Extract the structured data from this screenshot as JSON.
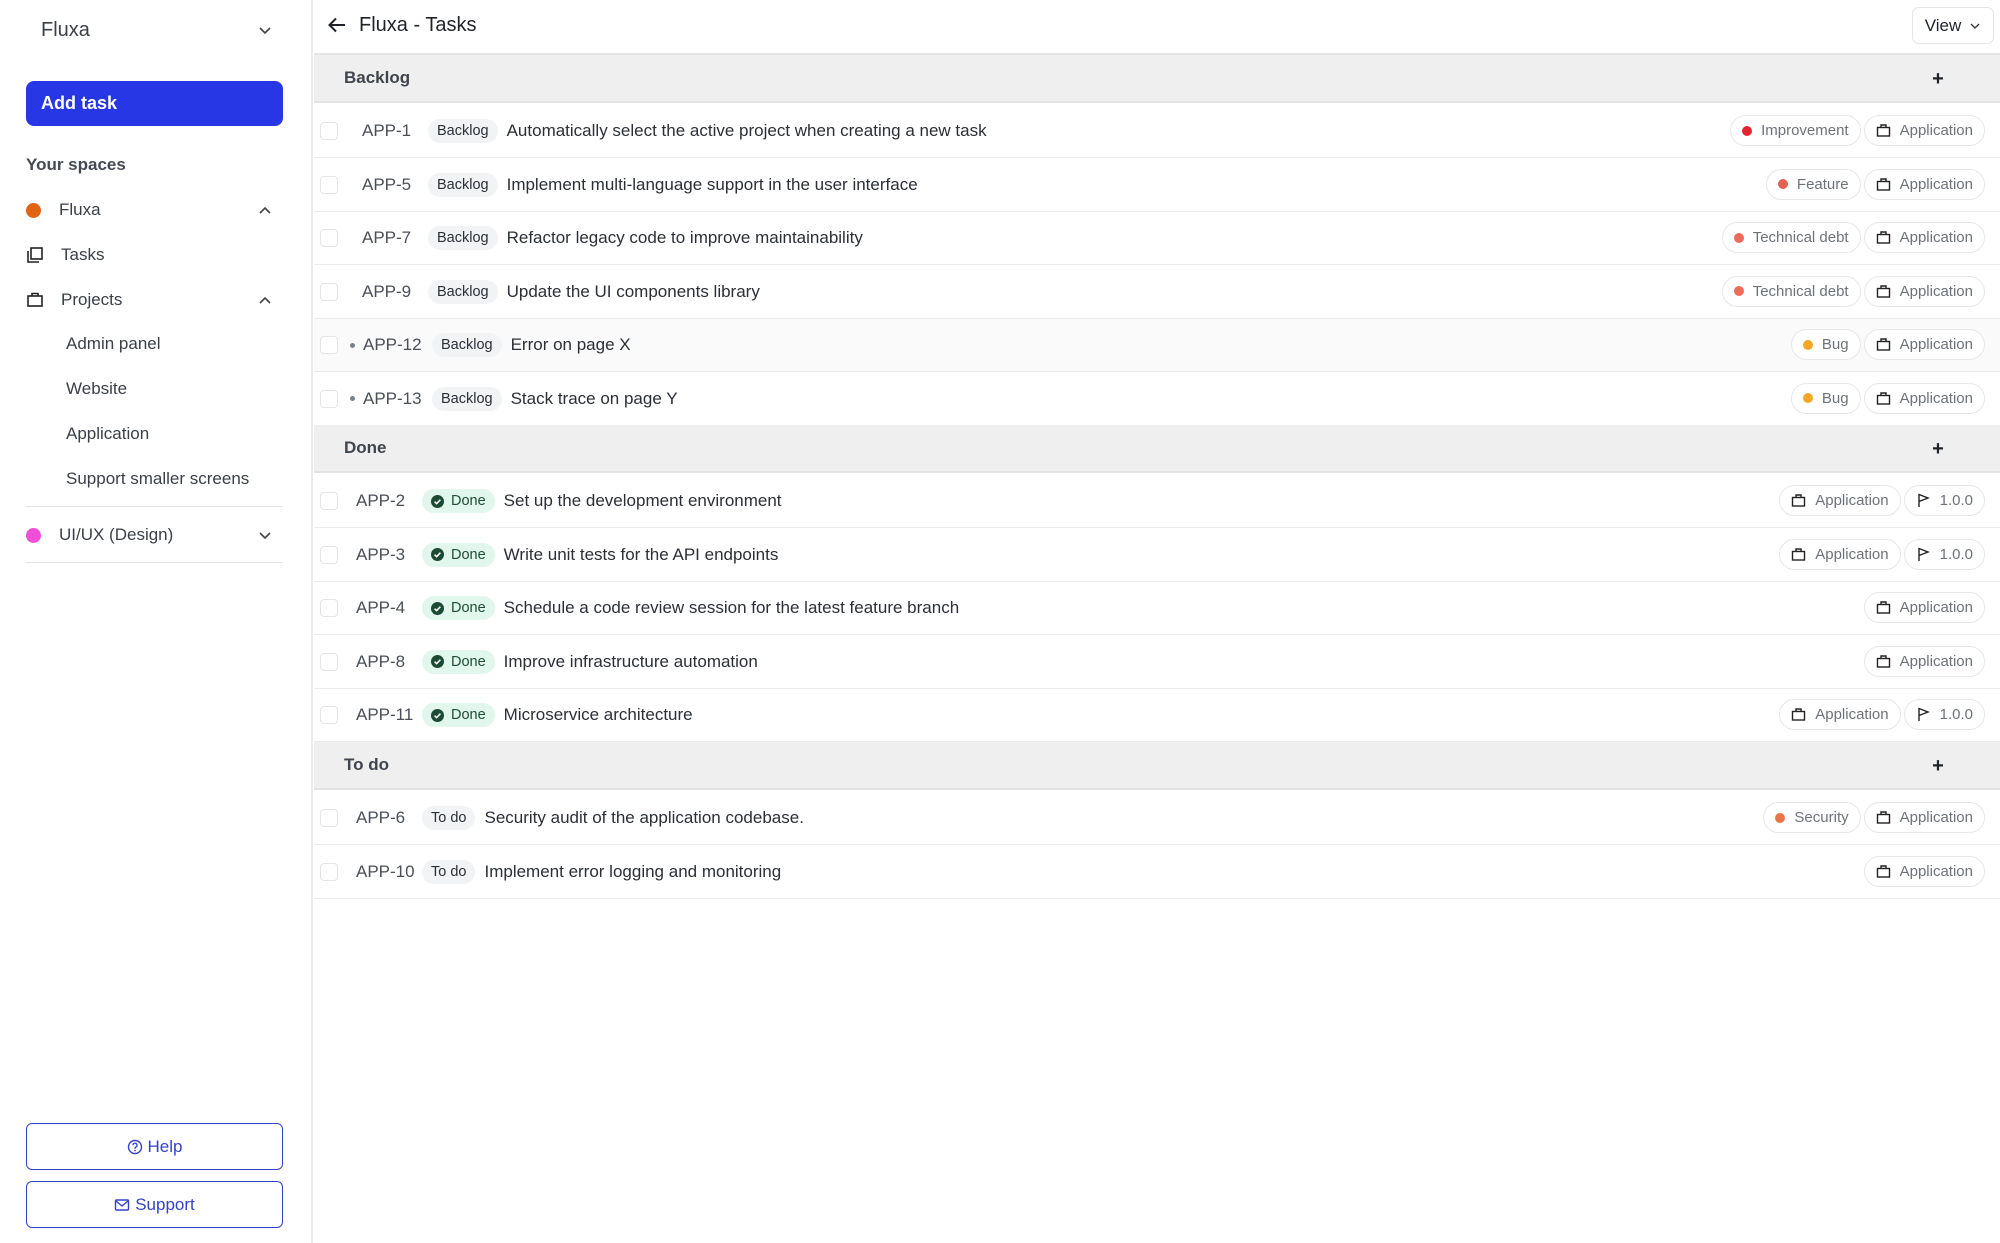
{
  "sidebar": {
    "workspace_name": "Fluxa",
    "add_task_label": "Add task",
    "spaces_title": "Your spaces",
    "spaces": [
      {
        "name": "Fluxa",
        "color": "#df6514",
        "expanded": true
      },
      {
        "name": "UI/UX (Design)",
        "color": "#f24fd8",
        "expanded": false
      }
    ],
    "nav": {
      "tasks_label": "Tasks",
      "projects_label": "Projects",
      "projects": [
        "Admin panel",
        "Website",
        "Application",
        "Support smaller screens"
      ]
    },
    "help_label": "Help",
    "support_label": "Support"
  },
  "header": {
    "title": "Fluxa - Tasks",
    "view_label": "View"
  },
  "colors": {
    "accent": "#2837e6",
    "improvement": "#e5252f",
    "feature": "#e4614f",
    "technical_debt": "#ef6a5a",
    "bug": "#f5a623",
    "security": "#e87448",
    "done_bg": "#e1f6ec"
  },
  "groups": [
    {
      "title": "Backlog",
      "add_label": "+",
      "tasks": [
        {
          "key": "APP-1",
          "status": "Backlog",
          "title": "Automatically select the active project when creating a new task",
          "label": "Improvement",
          "label_color": "#e5252f",
          "project": "Application"
        },
        {
          "key": "APP-5",
          "status": "Backlog",
          "title": "Implement multi-language support in the user interface",
          "label": "Feature",
          "label_color": "#e4614f",
          "project": "Application"
        },
        {
          "key": "APP-7",
          "status": "Backlog",
          "title": "Refactor legacy code to improve maintainability",
          "label": "Technical debt",
          "label_color": "#ef6a5a",
          "project": "Application"
        },
        {
          "key": "APP-9",
          "status": "Backlog",
          "title": "Update the UI components library",
          "label": "Technical debt",
          "label_color": "#ef6a5a",
          "project": "Application"
        },
        {
          "key": "APP-12",
          "status": "Backlog",
          "title": "Error on page X",
          "label": "Bug",
          "label_color": "#f5a623",
          "project": "Application",
          "subtask": true
        },
        {
          "key": "APP-13",
          "status": "Backlog",
          "title": "Stack trace on page Y",
          "label": "Bug",
          "label_color": "#f5a623",
          "project": "Application",
          "subtask": true
        }
      ]
    },
    {
      "title": "Done",
      "add_label": "+",
      "tasks": [
        {
          "key": "APP-2",
          "status": "Done",
          "title": "Set up the development environment",
          "project": "Application",
          "version": "1.0.0"
        },
        {
          "key": "APP-3",
          "status": "Done",
          "title": "Write unit tests for the API endpoints",
          "project": "Application",
          "version": "1.0.0"
        },
        {
          "key": "APP-4",
          "status": "Done",
          "title": "Schedule a code review session for the latest feature branch",
          "project": "Application"
        },
        {
          "key": "APP-8",
          "status": "Done",
          "title": "Improve infrastructure automation",
          "project": "Application"
        },
        {
          "key": "APP-11",
          "status": "Done",
          "title": "Microservice architecture",
          "project": "Application",
          "version": "1.0.0"
        }
      ]
    },
    {
      "title": "To do",
      "add_label": "+",
      "tasks": [
        {
          "key": "APP-6",
          "status": "To do",
          "title": "Security audit of the application codebase.",
          "label": "Security",
          "label_color": "#e87448",
          "project": "Application"
        },
        {
          "key": "APP-10",
          "status": "To do",
          "title": "Implement error logging and monitoring",
          "project": "Application"
        }
      ]
    }
  ]
}
